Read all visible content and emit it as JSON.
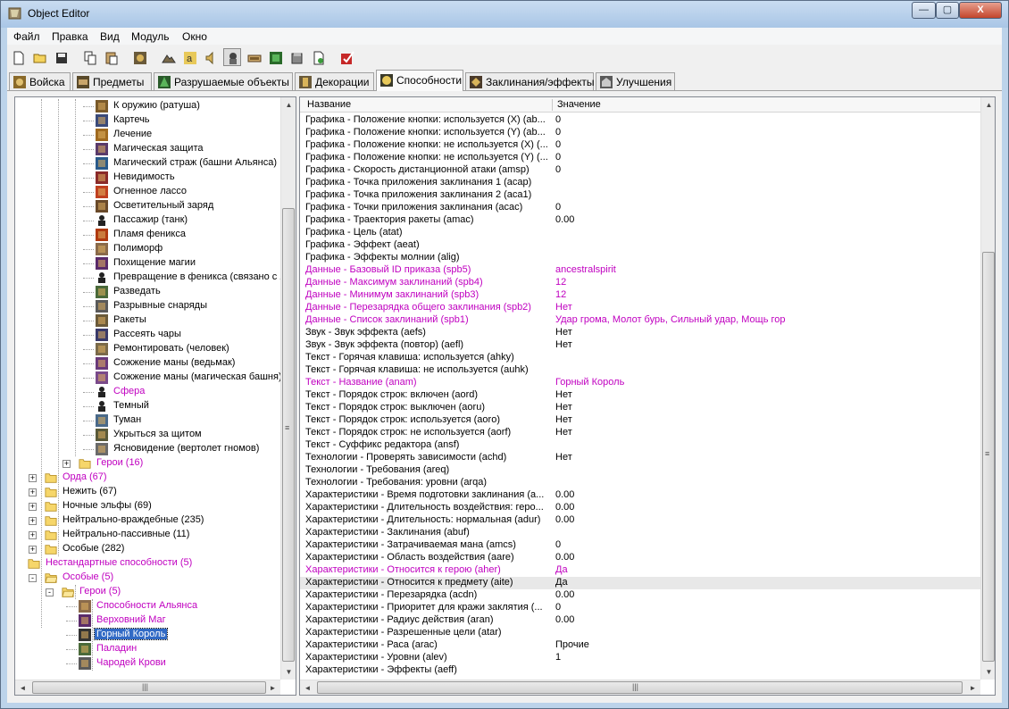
{
  "window": {
    "title": "Object Editor",
    "minimize": "—",
    "maximize": "▢",
    "close": "X"
  },
  "menu": [
    "Файл",
    "Правка",
    "Вид",
    "Модуль",
    "Окно"
  ],
  "tabs": [
    {
      "label": "Войска",
      "icon": "units-icon"
    },
    {
      "label": "Предметы",
      "icon": "items-icon"
    },
    {
      "label": "Разрушаемые объекты",
      "icon": "destructibles-icon"
    },
    {
      "label": "Декорации",
      "icon": "doodads-icon"
    },
    {
      "label": "Способности",
      "icon": "abilities-icon",
      "active": true
    },
    {
      "label": "Заклинания/эффекты",
      "icon": "buffs-icon"
    },
    {
      "label": "Улучшения",
      "icon": "upgrades-icon"
    }
  ],
  "tree": [
    {
      "label": "К оружию (ратуша)",
      "magenta": false
    },
    {
      "label": "Картечь",
      "magenta": false
    },
    {
      "label": "Лечение",
      "magenta": false
    },
    {
      "label": "Магическая защита",
      "magenta": false
    },
    {
      "label": "Магический страж (башни Альянса)",
      "magenta": false
    },
    {
      "label": "Невидимость",
      "magenta": false
    },
    {
      "label": "Огненное лассо",
      "magenta": false
    },
    {
      "label": "Осветительный заряд",
      "magenta": false
    },
    {
      "label": "Пассажир (танк)",
      "magenta": false
    },
    {
      "label": "Пламя феникса",
      "magenta": false
    },
    {
      "label": "Полиморф",
      "magenta": false
    },
    {
      "label": "Похищение магии",
      "magenta": false
    },
    {
      "label": "Превращение в феникса (связано с яйцом",
      "magenta": false
    },
    {
      "label": "Разведать",
      "magenta": false
    },
    {
      "label": "Разрывные снаряды",
      "magenta": false
    },
    {
      "label": "Ракеты",
      "magenta": false
    },
    {
      "label": "Рассеять чары",
      "magenta": false
    },
    {
      "label": "Ремонтировать (человек)",
      "magenta": false
    },
    {
      "label": "Сожжение маны (ведьмак)",
      "magenta": false
    },
    {
      "label": "Сожжение маны (магическая башня)",
      "magenta": false
    },
    {
      "label": "Сфера",
      "magenta": true
    },
    {
      "label": "Темный",
      "magenta": false
    },
    {
      "label": "Туман",
      "magenta": false
    },
    {
      "label": "Укрыться за щитом",
      "magenta": false
    },
    {
      "label": "Ясновидение (вертолет гномов)",
      "magenta": false
    },
    {
      "label": "Герои (16)",
      "magenta": true
    },
    {
      "label": "Орда (67)",
      "magenta": true
    },
    {
      "label": "Нежить (67)",
      "magenta": false
    },
    {
      "label": "Ночные эльфы (69)",
      "magenta": false
    },
    {
      "label": "Нейтрально-враждебные (235)",
      "magenta": false
    },
    {
      "label": "Нейтрально-пассивные (11)",
      "magenta": false
    },
    {
      "label": "Особые (282)",
      "magenta": false
    },
    {
      "label": "Нестандартные способности (5)",
      "magenta": true
    },
    {
      "label": "Особые (5)",
      "magenta": true
    },
    {
      "label": "Герои (5)",
      "magenta": true
    },
    {
      "label": "Способности Альянса",
      "magenta": true
    },
    {
      "label": "Верховний Маг",
      "magenta": true
    },
    {
      "label": "Горный Король",
      "magenta": false,
      "selected": true
    },
    {
      "label": "Паладин",
      "magenta": true
    },
    {
      "label": "Чародей Крови",
      "magenta": true
    }
  ],
  "grid": {
    "col_name": "Название",
    "col_value": "Значение",
    "rows": [
      {
        "name": "Графика - Положение кнопки: используется (X) (ab...",
        "value": "0",
        "magenta": false
      },
      {
        "name": "Графика - Положение кнопки: используется (Y) (ab...",
        "value": "0",
        "magenta": false
      },
      {
        "name": "Графика - Положение кнопки: не используется (X) (...",
        "value": "0",
        "magenta": false
      },
      {
        "name": "Графика - Положение кнопки: не используется (Y) (...",
        "value": "0",
        "magenta": false
      },
      {
        "name": "Графика - Скорость дистанционной атаки (amsp)",
        "value": "0",
        "magenta": false
      },
      {
        "name": "Графика - Точка приложения заклинания 1 (acap)",
        "value": "",
        "magenta": false
      },
      {
        "name": "Графика - Точка приложения заклинания 2 (aca1)",
        "value": "",
        "magenta": false
      },
      {
        "name": "Графика - Точки приложения заклинания (acac)",
        "value": "0",
        "magenta": false
      },
      {
        "name": "Графика - Траектория ракеты (amac)",
        "value": "0.00",
        "magenta": false
      },
      {
        "name": "Графика - Цель (atat)",
        "value": "",
        "magenta": false
      },
      {
        "name": "Графика - Эффект (aeat)",
        "value": "",
        "magenta": false
      },
      {
        "name": "Графика - Эффекты молнии (alig)",
        "value": "",
        "magenta": false
      },
      {
        "name": "Данные - Базовый ID приказа (spb5)",
        "value": "ancestralspirit",
        "magenta": true
      },
      {
        "name": "Данные - Максимум заклинаний (spb4)",
        "value": "12",
        "magenta": true
      },
      {
        "name": "Данные - Минимум заклинаний (spb3)",
        "value": "12",
        "magenta": true
      },
      {
        "name": "Данные - Перезарядка общего заклинания (spb2)",
        "value": "Нет",
        "magenta": true
      },
      {
        "name": "Данные - Список заклинаний (spb1)",
        "value": "Удар грома, Молот бурь, Сильный удар, Мощь гор",
        "magenta": true
      },
      {
        "name": "Звук - Звук эффекта (aefs)",
        "value": "Нет",
        "magenta": false
      },
      {
        "name": "Звук - Звук эффекта (повтор) (aefl)",
        "value": "Нет",
        "magenta": false
      },
      {
        "name": "Текст - Горячая клавиша: используется (ahky)",
        "value": "",
        "magenta": false
      },
      {
        "name": "Текст - Горячая клавиша: не используется (auhk)",
        "value": "",
        "magenta": false
      },
      {
        "name": "Текст - Название (anam)",
        "value": "Горный Король",
        "magenta": true
      },
      {
        "name": "Текст - Порядок строк: включен (aord)",
        "value": "Нет",
        "magenta": false
      },
      {
        "name": "Текст - Порядок строк: выключен (aoru)",
        "value": "Нет",
        "magenta": false
      },
      {
        "name": "Текст - Порядок строк: используется (aoro)",
        "value": "Нет",
        "magenta": false
      },
      {
        "name": "Текст - Порядок строк: не используется (aorf)",
        "value": "Нет",
        "magenta": false
      },
      {
        "name": "Текст - Суффикс редактора (ansf)",
        "value": "",
        "magenta": false
      },
      {
        "name": "Технологии - Проверять зависимости (achd)",
        "value": "Нет",
        "magenta": false
      },
      {
        "name": "Технологии - Требования (areq)",
        "value": "",
        "magenta": false
      },
      {
        "name": "Технологии - Требования: уровни (arqa)",
        "value": "",
        "magenta": false
      },
      {
        "name": "Характеристики - Время подготовки заклинания (a...",
        "value": "0.00",
        "magenta": false
      },
      {
        "name": "Характеристики - Длительность воздействия: геро...",
        "value": "0.00",
        "magenta": false
      },
      {
        "name": "Характеристики - Длительность: нормальная (adur)",
        "value": "0.00",
        "magenta": false
      },
      {
        "name": "Характеристики - Заклинания (abuf)",
        "value": "",
        "magenta": false
      },
      {
        "name": "Характеристики - Затрачиваемая мана (amcs)",
        "value": "0",
        "magenta": false
      },
      {
        "name": "Характеристики - Область воздействия (aare)",
        "value": "0.00",
        "magenta": false
      },
      {
        "name": "Характеристики - Относится к герою (aher)",
        "value": "Да",
        "magenta": true
      },
      {
        "name": "Характеристики - Относится к предмету (aite)",
        "value": "Да",
        "magenta": false,
        "highlight": true
      },
      {
        "name": "Характеристики - Перезарядка (acdn)",
        "value": "0.00",
        "magenta": false
      },
      {
        "name": "Характеристики - Приоритет для кражи заклятия (...",
        "value": "0",
        "magenta": false
      },
      {
        "name": "Характеристики - Радиус действия (aran)",
        "value": "0.00",
        "magenta": false
      },
      {
        "name": "Характеристики - Разрешенные цели (atar)",
        "value": "",
        "magenta": false
      },
      {
        "name": "Характеристики - Раса (arac)",
        "value": "Прочие",
        "magenta": false
      },
      {
        "name": "Характеристики - Уровни (alev)",
        "value": "1",
        "magenta": false
      },
      {
        "name": "Характеристики - Эффекты (aeff)",
        "value": "",
        "magenta": false
      }
    ]
  },
  "scroll": {
    "up": "▲",
    "down": "▼",
    "left": "◄",
    "right": "►",
    "grip": "≡",
    "hgrip": "|||"
  },
  "toolbar_icons": [
    "new-icon",
    "open-icon",
    "save-icon",
    "copy-icon",
    "paste-icon",
    "unit-icon",
    "terrain-icon",
    "doodad-icon",
    "sound-icon",
    "object-icon",
    "camera-icon",
    "region-icon",
    "ai-icon",
    "import-icon",
    "check-icon"
  ],
  "colors": {
    "magenta": "#c000c0",
    "selection": "#316ac5"
  }
}
